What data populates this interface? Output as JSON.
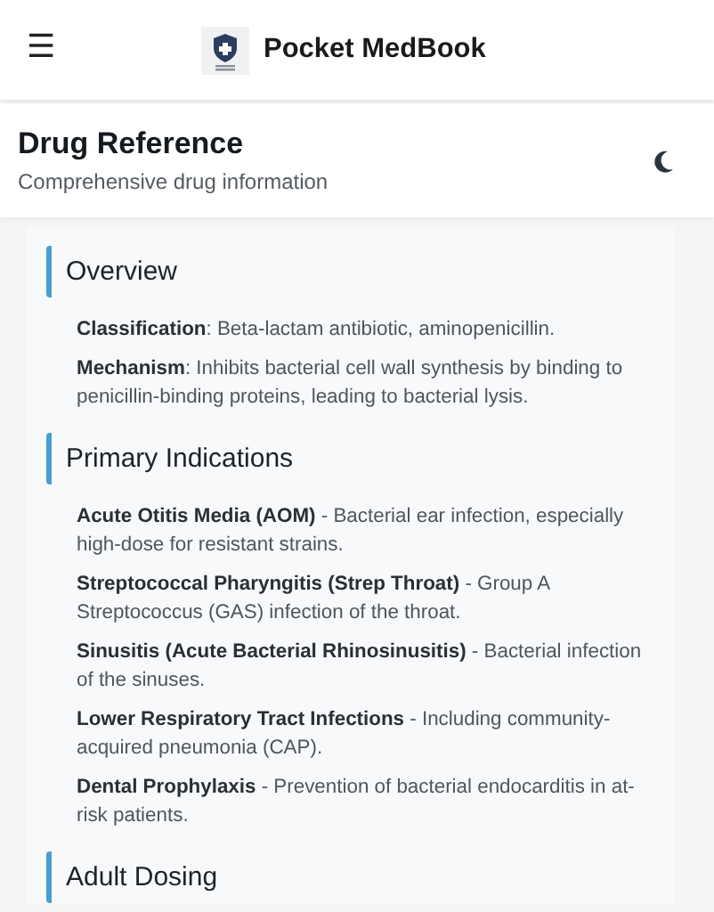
{
  "app_bar": {
    "menu_icon": "☰",
    "title": "Pocket MedBook"
  },
  "page_header": {
    "title": "Drug Reference",
    "subtitle": "Comprehensive drug information"
  },
  "sections": [
    {
      "title": "Overview",
      "items": [
        {
          "text": "**Classification**: Beta-lactam antibiotic, aminopenicillin."
        },
        {
          "text": "**Mechanism**: Inhibits bacterial cell wall synthesis by binding to penicillin-binding proteins, leading to bacterial lysis."
        }
      ]
    },
    {
      "title": "Primary Indications",
      "items": [
        {
          "text": "**Acute Otitis Media (AOM)** - Bacterial ear infection, especially high-dose for resistant strains."
        },
        {
          "text": "**Streptococcal Pharyngitis (Strep Throat)** - Group A Streptococcus (GAS) infection of the throat."
        },
        {
          "text": "**Sinusitis (Acute Bacterial Rhinosinusitis)** - Bacterial infection of the sinuses."
        },
        {
          "text": "**Lower Respiratory Tract Infections** - Including community-acquired pneumonia (CAP)."
        },
        {
          "text": "**Dental Prophylaxis** - Prevention of bacterial endocarditis in at-risk patients."
        }
      ]
    },
    {
      "title": "Adult Dosing"
    }
  ]
}
